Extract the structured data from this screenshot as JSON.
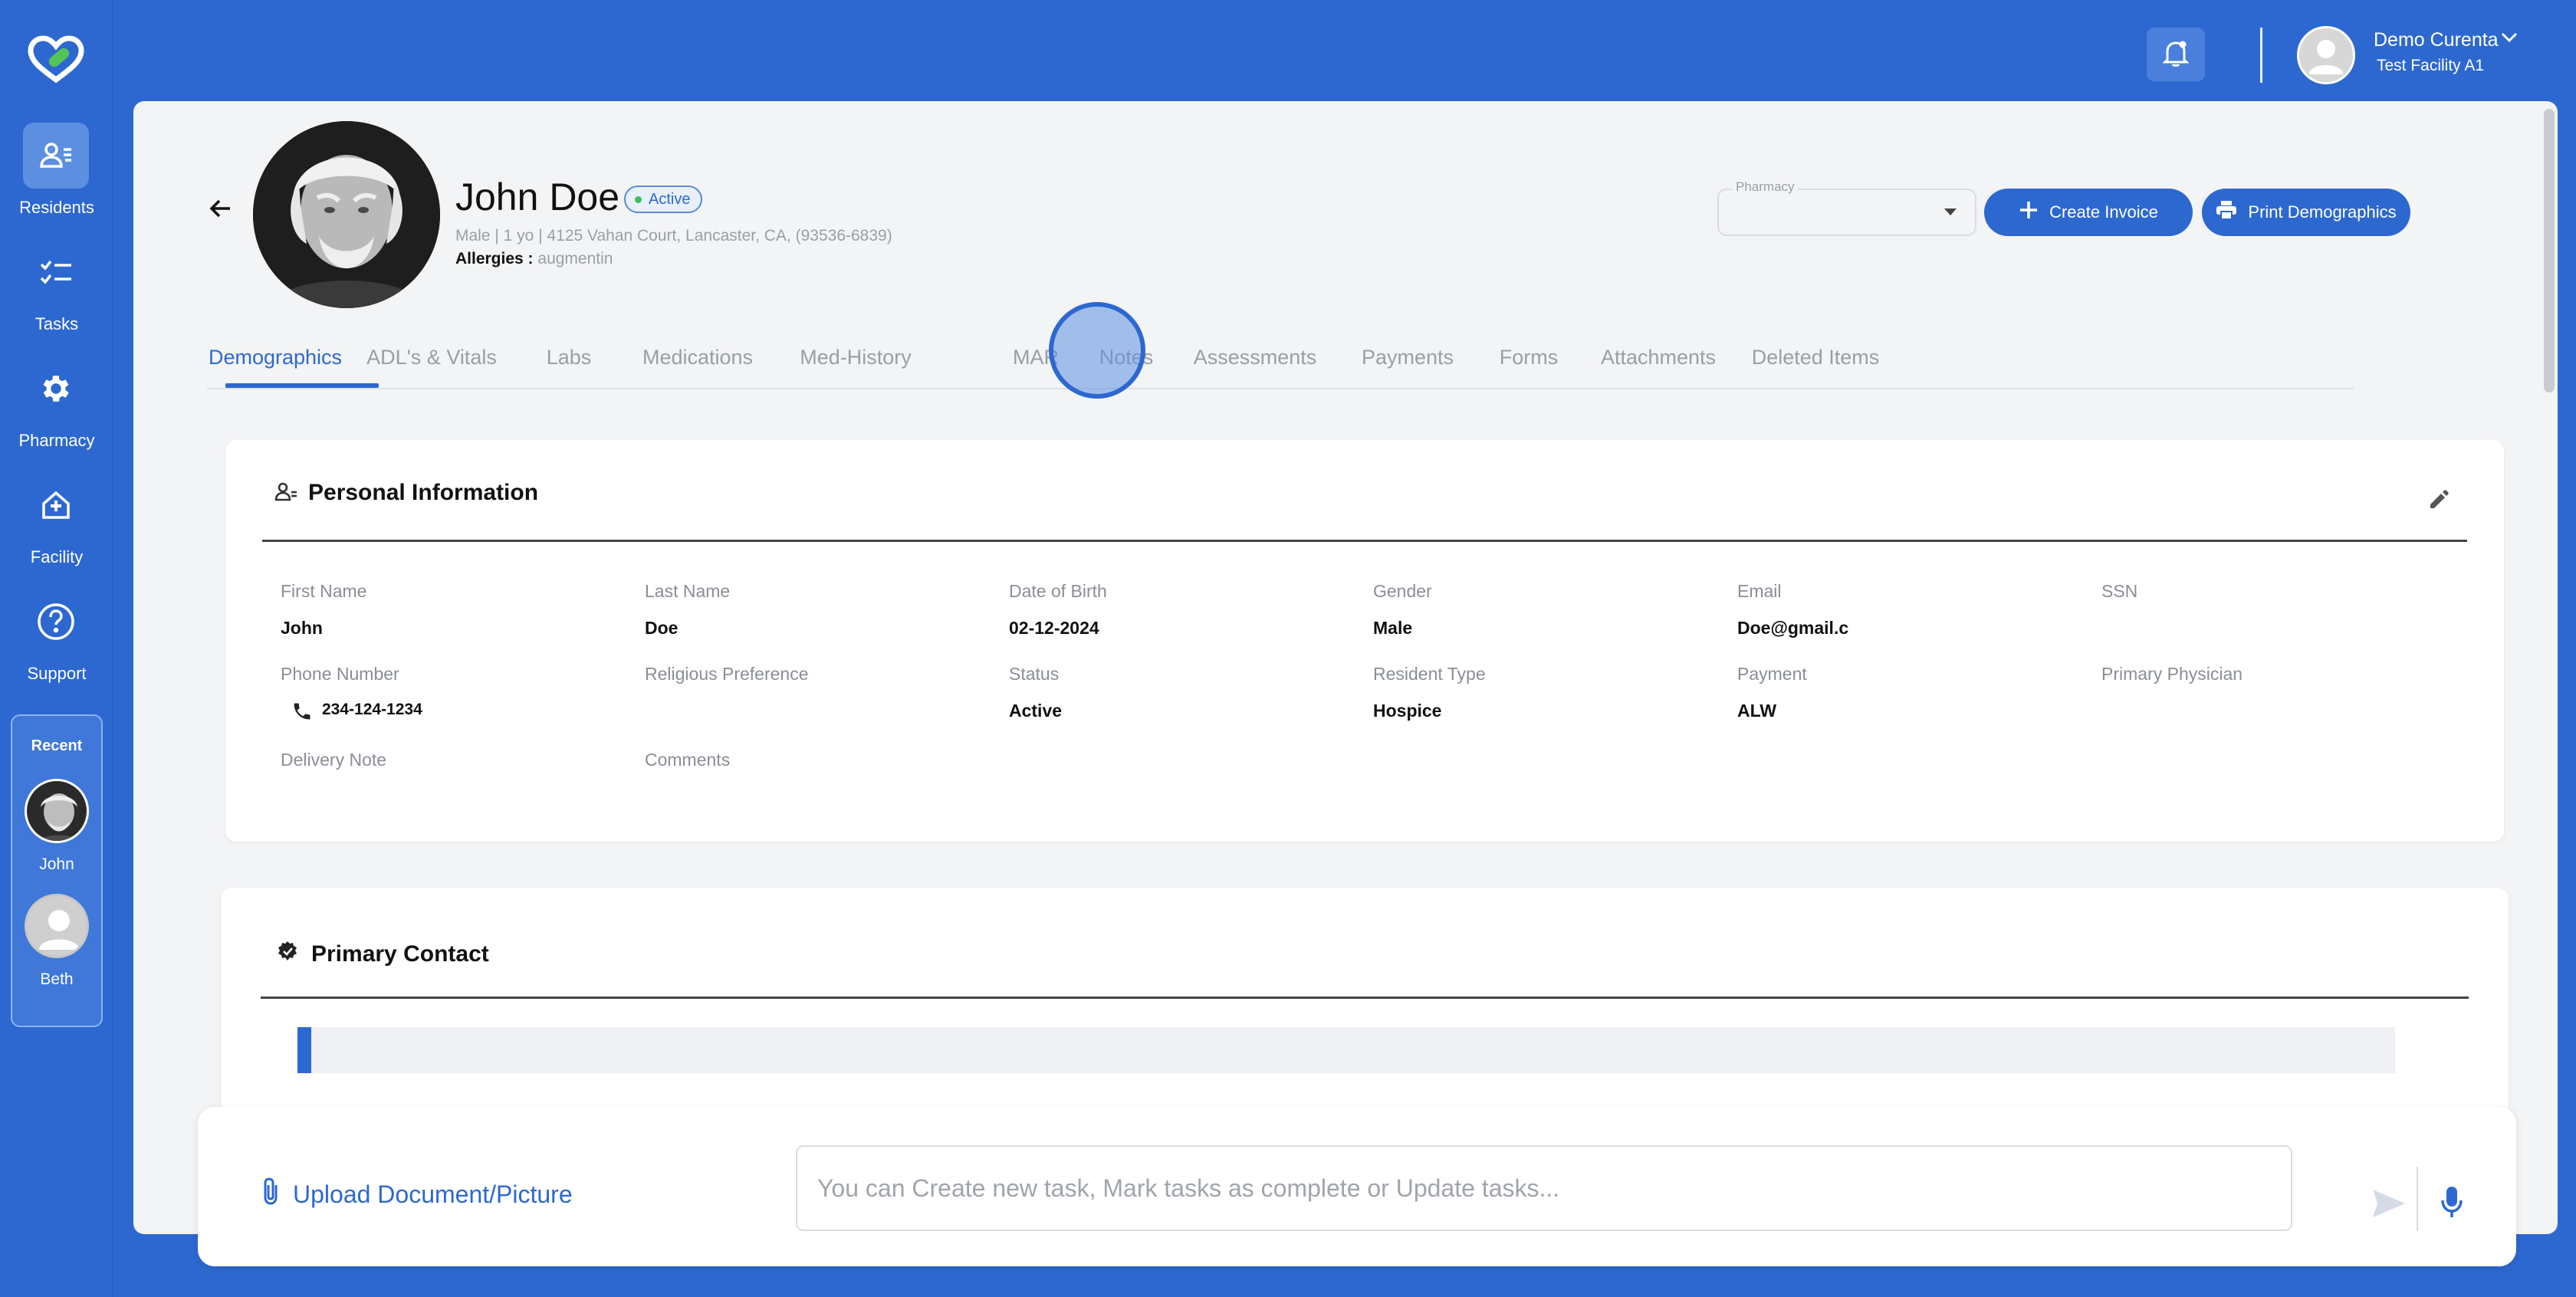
{
  "sidebar": {
    "items": [
      {
        "label": "Residents",
        "icon": "residents-icon",
        "active": true
      },
      {
        "label": "Tasks",
        "icon": "tasks-icon"
      },
      {
        "label": "Pharmacy",
        "icon": "gear-icon"
      },
      {
        "label": "Facility",
        "icon": "facility-icon"
      },
      {
        "label": "Support",
        "icon": "help-icon"
      }
    ],
    "recent": {
      "title": "Recent",
      "items": [
        {
          "name": "John"
        },
        {
          "name": "Beth"
        }
      ]
    }
  },
  "topbar": {
    "user_name": "Demo Curenta",
    "facility": "Test Facility A1"
  },
  "resident": {
    "name": "John Doe",
    "status": "Active",
    "meta": "Male | 1 yo | 4125 Vahan Court, Lancaster, CA, (93536-6839)",
    "allergies_label": "Allergies :",
    "allergies_value": "augmentin"
  },
  "actions": {
    "pharmacy_label": "Pharmacy",
    "pharmacy_value": "",
    "create_invoice": "Create Invoice",
    "print_demographics": "Print Demographics"
  },
  "tabs": [
    {
      "label": "Demographics",
      "active": true
    },
    {
      "label": "ADL's & Vitals"
    },
    {
      "label": "Labs"
    },
    {
      "label": "Medications"
    },
    {
      "label": "Med-History"
    },
    {
      "label": "MAR"
    },
    {
      "label": "Notes"
    },
    {
      "label": "Assessments"
    },
    {
      "label": "Payments"
    },
    {
      "label": "Forms"
    },
    {
      "label": "Attachments"
    },
    {
      "label": "Deleted Items"
    }
  ],
  "personal_info": {
    "title": "Personal Information",
    "fields": {
      "first_name": {
        "label": "First Name",
        "value": "John"
      },
      "last_name": {
        "label": "Last Name",
        "value": "Doe"
      },
      "dob": {
        "label": "Date of Birth",
        "value": "02-12-2024"
      },
      "gender": {
        "label": "Gender",
        "value": "Male"
      },
      "email": {
        "label": "Email",
        "value": "Doe@gmail.c"
      },
      "ssn": {
        "label": "SSN",
        "value": ""
      },
      "phone": {
        "label": "Phone Number",
        "value": "234-124-1234"
      },
      "religion": {
        "label": "Religious Preference",
        "value": ""
      },
      "status": {
        "label": "Status",
        "value": "Active"
      },
      "resident_type": {
        "label": "Resident Type",
        "value": "Hospice"
      },
      "payment": {
        "label": "Payment",
        "value": "ALW"
      },
      "physician": {
        "label": "Primary Physician",
        "value": ""
      },
      "delivery_note": {
        "label": "Delivery Note",
        "value": ""
      },
      "comments": {
        "label": "Comments",
        "value": ""
      }
    }
  },
  "primary_contact": {
    "title": "Primary Contact"
  },
  "chat": {
    "upload_label": "Upload Document/Picture",
    "placeholder": "You can Create new task, Mark tasks as complete or Update tasks..."
  },
  "colors": {
    "brand_blue": "#2d68d0",
    "background": "#f3f4f6",
    "active_green": "#3cbf5a"
  }
}
